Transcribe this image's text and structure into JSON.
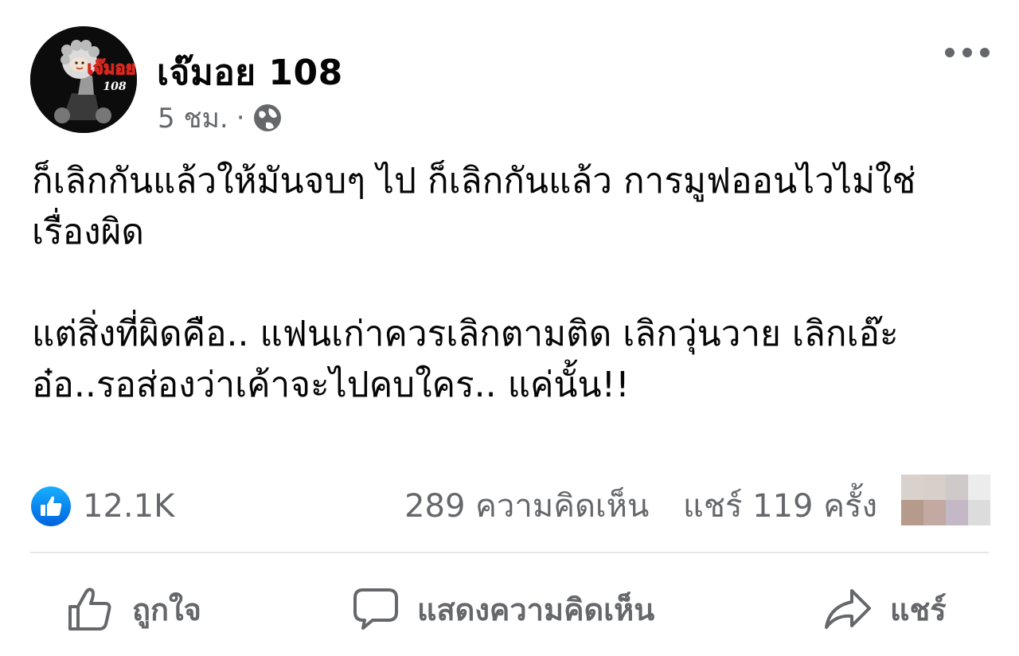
{
  "post": {
    "author": "เจ๊มอย 108",
    "time": "5 ชม.",
    "separator": "·",
    "avatar_logo_text": "เจ๊มอย",
    "avatar_logo_number": "108",
    "text_lines": [
      "ก็เลิกกันแล้วให้มันจบๆ ไป ก็เลิกกันแล้ว การมูฟออนไวไม่ใช่",
      "เรื่องผิด",
      "แต่สิ่งที่ผิดคือ.. แฟนเก่าควรเลิกตามติด เลิกวุ่นวาย เลิกเอ๊ะ",
      "อ๋อ..รอส่องว่าเค้าจะไปคบใคร.. แค่นั้น!!"
    ]
  },
  "stats": {
    "likes": "12.1K",
    "comments": "289 ความคิดเห็น",
    "shares": "แชร์ 119 ครั้ง"
  },
  "actions": {
    "like": "ถูกใจ",
    "comment": "แสดงความคิดเห็น",
    "share": "แชร์"
  },
  "icons": {
    "more": "more-dots-icon",
    "privacy": "globe-icon",
    "like_badge": "thumbs-up-badge-icon",
    "like": "thumbs-up-outline-icon",
    "comment": "speech-bubble-icon",
    "share": "share-arrow-icon"
  },
  "colors": {
    "accent": "#1877f2",
    "secondary_text": "#65676b",
    "primary_text": "#050505",
    "divider": "#e4e6eb"
  }
}
